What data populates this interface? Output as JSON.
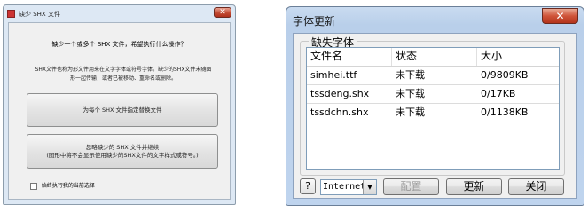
{
  "missing_shx_dialog": {
    "title": "缺少 SHX 文件",
    "close_glyph": "✕",
    "question": "缺少一个或多个 SHX 文件，希望执行什么操作？",
    "explanation_line1": "SHX文件也称为形文件用来在文字字体或符号字体。缺少的SHX文件未随图",
    "explanation_line2": "形一起传输，或者已被移动、重命名或删除。",
    "option_specify": "为每个 SHX 文件指定替换文件",
    "option_ignore_line1": "忽略缺少的 SHX 文件并继续",
    "option_ignore_line2": "(图形中将不会显示使用缺少的SHX文件的文字样式或符号。)",
    "always_checked": false,
    "always_label": "始终执行我的当前选择"
  },
  "font_update_dialog": {
    "title": "字体更新",
    "close_glyph": "✕",
    "group_label": "缺失字体",
    "columns": [
      "文件名",
      "状态",
      "大小"
    ],
    "rows": [
      {
        "file": "simhei.ttf",
        "status": "未下载",
        "size": "0/9809KB"
      },
      {
        "file": "tssdeng.shx",
        "status": "未下载",
        "size": "0/17KB"
      },
      {
        "file": "tssdchn.shx",
        "status": "未下载",
        "size": "0/1138KB"
      }
    ],
    "help_label": "?",
    "source_selected": "Internet",
    "combo_arrow": "▼",
    "config_label": "配置",
    "update_label": "更新",
    "close_label": "关闭"
  }
}
